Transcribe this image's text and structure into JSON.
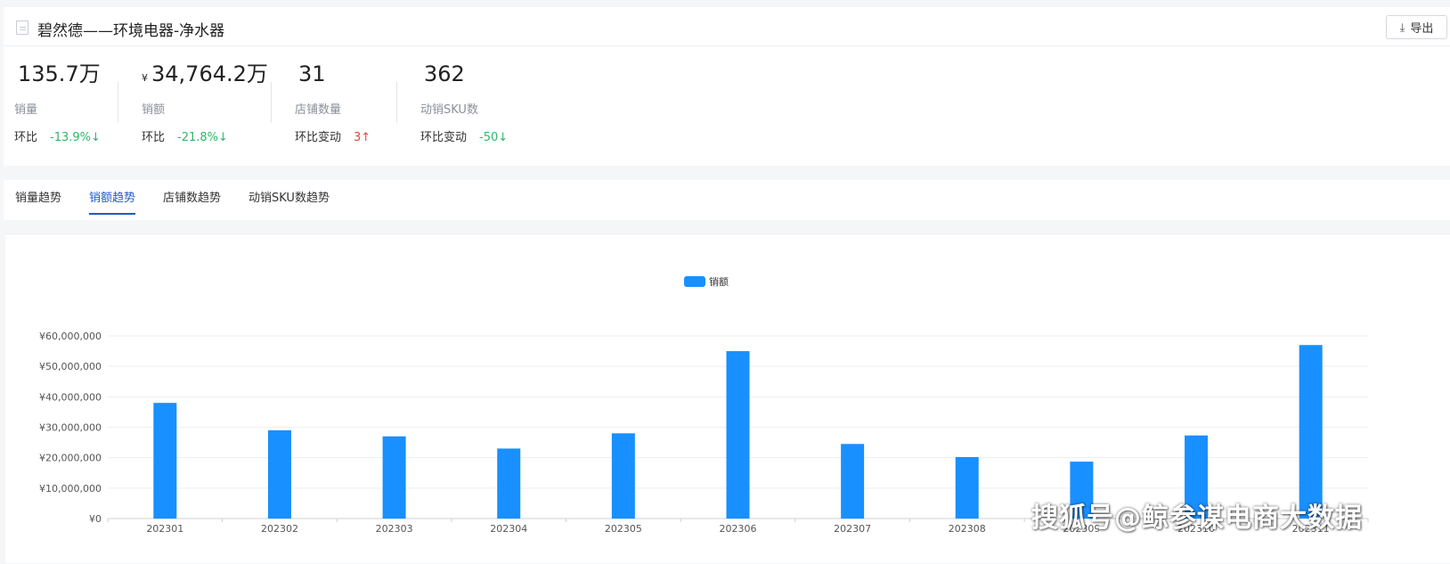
{
  "header": {
    "title": "碧然德——环境电器-净水器",
    "export_label": "导出",
    "export_icon": "download-icon"
  },
  "metrics": [
    {
      "value": "135.7万",
      "currency": "",
      "label": "销量",
      "compare_label": "环比",
      "compare_value": "-13.9%",
      "direction": "down",
      "arrow": "↓"
    },
    {
      "value": "34,764.2万",
      "currency": "¥",
      "label": "销额",
      "compare_label": "环比",
      "compare_value": "-21.8%",
      "direction": "down",
      "arrow": "↓"
    },
    {
      "value": "31",
      "currency": "",
      "label": "店铺数量",
      "compare_label": "环比变动",
      "compare_value": "3",
      "direction": "up",
      "arrow": "↑"
    },
    {
      "value": "362",
      "currency": "",
      "label": "动销SKU数",
      "compare_label": "环比变动",
      "compare_value": "-50",
      "direction": "down",
      "arrow": "↓"
    }
  ],
  "tabs": [
    {
      "label": "销量趋势",
      "active": false
    },
    {
      "label": "销额趋势",
      "active": true
    },
    {
      "label": "店铺数趋势",
      "active": false
    },
    {
      "label": "动销SKU数趋势",
      "active": false
    }
  ],
  "watermark": "搜狐号@鲸参谋电商大数据",
  "chart_data": {
    "type": "bar",
    "categories": [
      "202301",
      "202302",
      "202303",
      "202304",
      "202305",
      "202306",
      "202307",
      "202308",
      "202309",
      "202310",
      "202311"
    ],
    "series": [
      {
        "name": "销额",
        "values": [
          38000000,
          29000000,
          27000000,
          23000000,
          28000000,
          55000000,
          24500000,
          20200000,
          18700000,
          27300000,
          57000000
        ]
      }
    ],
    "ylim": [
      0,
      60000000
    ],
    "yticks": [
      "¥0",
      "¥10,000,000",
      "¥20,000,000",
      "¥30,000,000",
      "¥40,000,000",
      "¥50,000,000",
      "¥60,000,000"
    ],
    "legend": "top-center",
    "grid": true,
    "bar_color": "#1890ff"
  },
  "colors": {
    "accent": "#1f59c8",
    "down": "#2bb868",
    "up": "#e5453a"
  }
}
